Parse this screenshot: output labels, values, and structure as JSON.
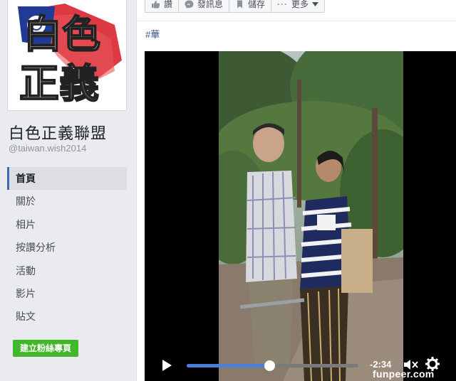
{
  "sidebar": {
    "logo_text_top": "白色",
    "logo_text_bottom": "正義",
    "page_name": "白色正義聯盟",
    "page_handle": "@taiwan.wish2014",
    "nav": [
      {
        "label": "首頁",
        "active": true
      },
      {
        "label": "關於",
        "active": false
      },
      {
        "label": "相片",
        "active": false
      },
      {
        "label": "按讚分析",
        "active": false
      },
      {
        "label": "活動",
        "active": false
      },
      {
        "label": "影片",
        "active": false
      },
      {
        "label": "貼文",
        "active": false
      }
    ],
    "create_button": "建立粉絲專頁"
  },
  "toolbar": {
    "like_label": "讚",
    "message_label": "發訊息",
    "save_label": "儲存",
    "more_label": "更多"
  },
  "post": {
    "hashtag": "#華"
  },
  "video": {
    "time_remaining": "-2:34",
    "progress": 0.48,
    "watermark": "funpeer.com"
  },
  "colors": {
    "accent": "#4267b2",
    "link": "#385898",
    "create_button": "#42b72a",
    "progress_fill": "#4a7fd8"
  }
}
